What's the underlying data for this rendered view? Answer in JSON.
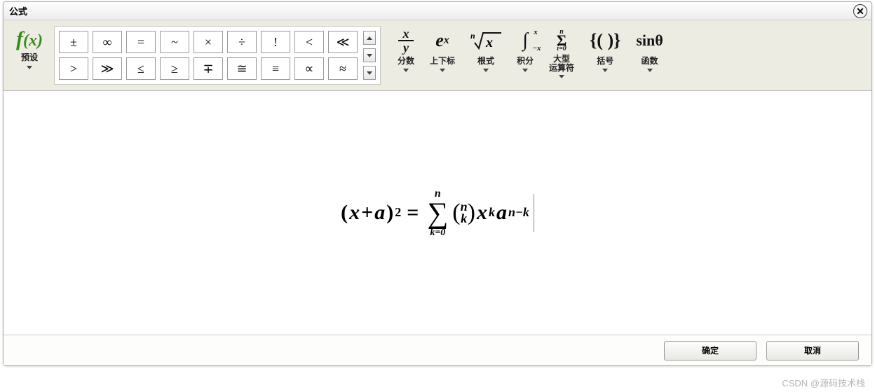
{
  "title": "公式",
  "close": "✕",
  "preset": {
    "label": "预设",
    "icon": "f(x)"
  },
  "symbols": {
    "row1": [
      "±",
      "∞",
      "=",
      "~",
      "×",
      "÷",
      "!",
      "<",
      "≪"
    ],
    "row2": [
      ">",
      "≫",
      "≤",
      "≥",
      "∓",
      "≅",
      "≡",
      "∝",
      "≈"
    ]
  },
  "categories": [
    {
      "id": "fraction",
      "label": "分数"
    },
    {
      "id": "script",
      "label": "上下标",
      "icon_text": "e",
      "icon_sup": "x"
    },
    {
      "id": "radical",
      "label": "根式"
    },
    {
      "id": "integral",
      "label": "积分"
    },
    {
      "id": "bigop",
      "label": "大型\n运算符"
    },
    {
      "id": "bracket",
      "label": "括号",
      "icon_text": "{( )}"
    },
    {
      "id": "function",
      "label": "函数",
      "icon_text": "sinθ"
    }
  ],
  "formula": {
    "lhs_open": "(",
    "lhs_var1": "x",
    "lhs_plus": "+",
    "lhs_var2": "a",
    "lhs_close": ")",
    "lhs_sup": "2",
    "eq": "=",
    "sum_above": "n",
    "sum_below": "k=0",
    "binom_top": "n",
    "binom_bot": "k",
    "rhs_x": "x",
    "rhs_x_sup": "k",
    "rhs_a": "a",
    "rhs_a_sup": "n−k"
  },
  "buttons": {
    "ok": "确定",
    "cancel": "取消"
  },
  "watermark": "CSDN @源码技术栈"
}
